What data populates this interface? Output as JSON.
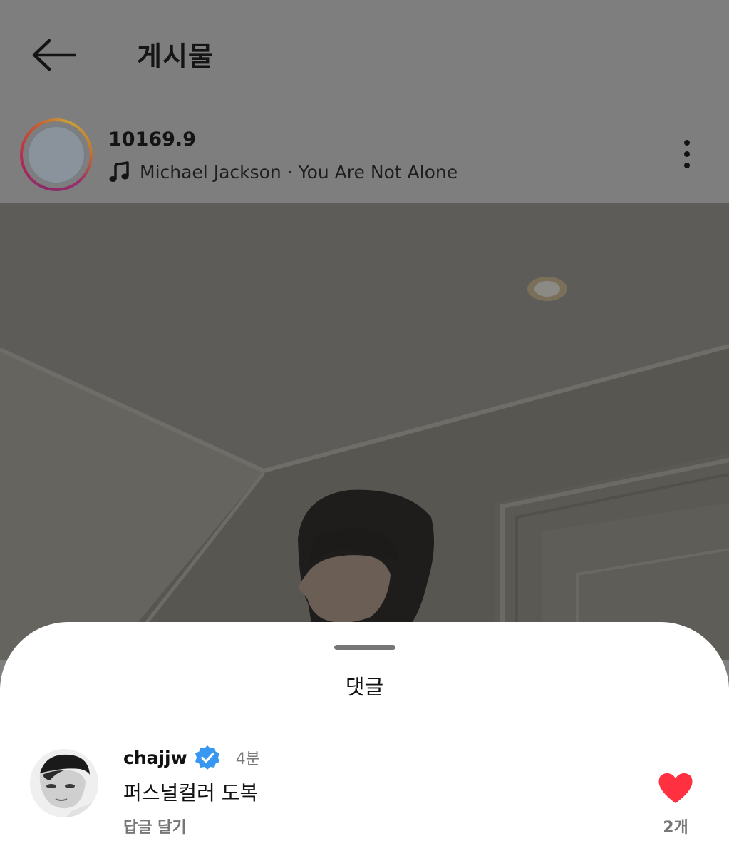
{
  "header": {
    "title": "게시물",
    "back_icon": "arrow-left-icon"
  },
  "post": {
    "username": "10169.9",
    "music_icon": "music-note-icon",
    "music": "Michael Jackson · You Are Not Alone",
    "more_icon": "more-vertical-icon"
  },
  "comments_sheet": {
    "title": "댓글",
    "comments": [
      {
        "username": "chajjw",
        "verified": true,
        "time": "4분",
        "text": "퍼스널컬러 도복",
        "reply_label": "답글 달기",
        "like_count": "2개",
        "liked": true
      }
    ]
  },
  "colors": {
    "dim_overlay": "#7e7e7e",
    "like_red": "#ff3040",
    "verified_blue": "#3897f0",
    "secondary_text": "#777777"
  }
}
